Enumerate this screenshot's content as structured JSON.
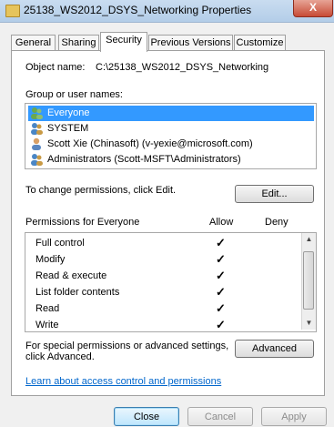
{
  "window": {
    "title": "25138_WS2012_DSYS_Networking Properties",
    "close_glyph": "X"
  },
  "tabs": [
    {
      "label": "General"
    },
    {
      "label": "Sharing"
    },
    {
      "label": "Security"
    },
    {
      "label": "Previous Versions"
    },
    {
      "label": "Customize"
    }
  ],
  "object": {
    "label": "Object name:",
    "value": "C:\\25138_WS2012_DSYS_Networking"
  },
  "groups": {
    "label": "Group or user names:",
    "items": [
      {
        "name": "Everyone",
        "icon": "users-group-icon",
        "selected": true
      },
      {
        "name": "SYSTEM",
        "icon": "users-group-icon",
        "selected": false
      },
      {
        "name": "Scott Xie (Chinasoft) (v-yexie@microsoft.com)",
        "icon": "user-icon",
        "selected": false
      },
      {
        "name": "Administrators (Scott-MSFT\\Administrators)",
        "icon": "users-group-icon",
        "selected": false
      }
    ]
  },
  "change_permissions": {
    "text": "To change permissions, click Edit.",
    "button": "Edit..."
  },
  "permissions": {
    "header": "Permissions for Everyone",
    "allow_header": "Allow",
    "deny_header": "Deny",
    "check_glyph": "✓",
    "rows": [
      {
        "name": "Full control",
        "allow": true,
        "deny": false
      },
      {
        "name": "Modify",
        "allow": true,
        "deny": false
      },
      {
        "name": "Read & execute",
        "allow": true,
        "deny": false
      },
      {
        "name": "List folder contents",
        "allow": true,
        "deny": false
      },
      {
        "name": "Read",
        "allow": true,
        "deny": false
      },
      {
        "name": "Write",
        "allow": true,
        "deny": false
      }
    ]
  },
  "advanced": {
    "text_line1": "For special permissions or advanced settings,",
    "text_line2": "click Advanced.",
    "button": "Advanced"
  },
  "help_link": "Learn about access control and permissions",
  "buttons": {
    "close": "Close",
    "cancel": "Cancel",
    "apply": "Apply"
  }
}
